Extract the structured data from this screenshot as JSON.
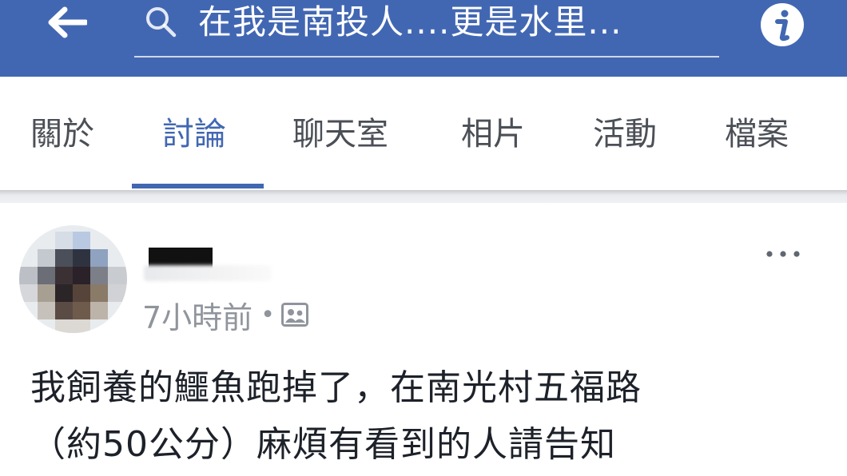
{
  "header": {
    "back_icon": "arrow-left-icon",
    "search_icon": "search-icon",
    "search_text": "在我是南投人....更是水里...",
    "info_icon": "info-icon",
    "color": "#4267b2"
  },
  "tabs": {
    "items": [
      {
        "label": "關於"
      },
      {
        "label": "討論"
      },
      {
        "label": "聊天室"
      },
      {
        "label": "相片"
      },
      {
        "label": "活動"
      },
      {
        "label": "檔案"
      }
    ],
    "active": "討論",
    "active_color": "#4267b2"
  },
  "post": {
    "time": "7小時前",
    "separator": "•",
    "audience_icon": "group-audience-icon",
    "more_icon": "more-options-icon",
    "text_lines": [
      "我飼養的鱷魚跑掉了，在南光村五福路",
      "（約50公分）麻煩有看到的人請告知"
    ]
  }
}
